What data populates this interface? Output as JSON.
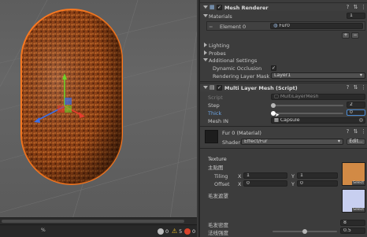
{
  "scene": {
    "status": {
      "percent": "%",
      "stat_a": "0",
      "stat_b": "5",
      "stat_c": "0"
    }
  },
  "inspector": {
    "mesh_renderer": {
      "title": "Mesh Renderer",
      "enabled": true,
      "materials_label": "Materials",
      "materials_count": "1",
      "element0_label": "Element 0",
      "element0_value": "Fur0",
      "lighting_label": "Lighting",
      "probes_label": "Probes",
      "additional_label": "Additional Settings",
      "dynamic_occlusion_label": "Dynamic Occlusion",
      "dynamic_occlusion": true,
      "rendering_layer_label": "Rendering Layer Mask",
      "rendering_layer_value": "Layer1"
    },
    "script_component": {
      "title": "Multi Layer Mesh (Script)",
      "enabled": true,
      "script_label": "Script",
      "script_value": "MultiLayerMesh",
      "step_label": "Step",
      "step_value": "2",
      "thick_label": "Thick",
      "thick_value": "0",
      "mesh_in_label": "Mesh IN",
      "mesh_in_value": "Capsule"
    },
    "material": {
      "title": "Fur 0 (Material)",
      "shader_label": "Shader",
      "shader_value": "Effect/Fur",
      "edit_label": "Edit...",
      "texture_label": "Texture",
      "texture_sublabel": "主贴图",
      "tiling_label": "Tiling",
      "tiling_x_label": "X",
      "tiling_x": "1",
      "tiling_y_label": "Y",
      "tiling_y": "1",
      "offset_label": "Offset",
      "offset_x_label": "X",
      "offset_x": "0",
      "offset_y_label": "Y",
      "offset_y": "0",
      "select_label": "Select",
      "fur_mask_label": "毛发遮罩",
      "fur_density_label": "毛发密度",
      "fur_density_value": "8",
      "fur_strength_label": "法线强度",
      "fur_strength_value": "0.5"
    }
  },
  "colors": {
    "accent_blue": "#4c8dd6",
    "fur_orange": "#b2551c",
    "outline_orange": "#ff7a1f",
    "axis_red": "#e53c2d",
    "axis_green": "#6fd22a",
    "axis_blue": "#3b6fe6"
  }
}
